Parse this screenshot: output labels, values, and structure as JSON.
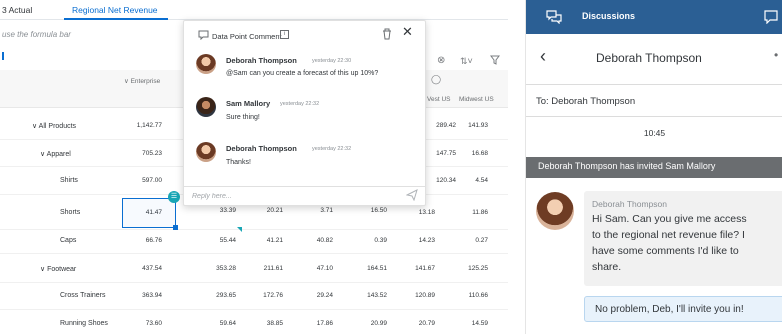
{
  "tabs": [
    {
      "label": "3 Actual",
      "active": false
    },
    {
      "label": "Regional Net Revenue",
      "active": true
    }
  ],
  "formula_hint": "use the formula bar",
  "columns": {
    "enterprise": "∨ Enterprise",
    "west_us": "Vest US",
    "midwest_us": "Midwest US"
  },
  "rows": [
    {
      "label": "∨ All Products",
      "values": [
        "1,142.77",
        "",
        "",
        "",
        "",
        "289.42",
        "141.93"
      ]
    },
    {
      "label": "∨ Apparel",
      "values": [
        "705.23",
        "",
        "",
        "",
        "",
        "147.75",
        "16.68"
      ]
    },
    {
      "label": "Shirts",
      "values": [
        "597.00",
        "",
        "",
        "",
        "",
        "120.34",
        "4.54"
      ]
    },
    {
      "label": "Shorts",
      "values": [
        "41.47",
        "33.39",
        "20.21",
        "3.71",
        "16.50",
        "13.18",
        "11.86"
      ]
    },
    {
      "label": "Caps",
      "values": [
        "66.76",
        "55.44",
        "41.21",
        "40.82",
        "0.39",
        "14.23",
        "0.27"
      ]
    },
    {
      "label": "∨ Footwear",
      "values": [
        "437.54",
        "353.28",
        "211.61",
        "47.10",
        "164.51",
        "141.67",
        "125.25"
      ]
    },
    {
      "label": "Cross Trainers",
      "values": [
        "363.94",
        "293.65",
        "172.76",
        "29.24",
        "143.52",
        "120.89",
        "110.66"
      ]
    },
    {
      "label": "Running Shoes",
      "values": [
        "73.60",
        "59.64",
        "38.85",
        "17.86",
        "20.99",
        "20.79",
        "14.59"
      ]
    }
  ],
  "popover": {
    "title": "Data Point Comment",
    "info": "i",
    "comments": [
      {
        "name": "Deborah Thompson",
        "time": "yesterday 22:30",
        "text": "@Sam can you create a forecast of this up 10%?"
      },
      {
        "name": "Sam Mallory",
        "time": "yesterday 22:32",
        "text": "Sure thing!"
      },
      {
        "name": "Deborah Thompson",
        "time": "yesterday 22:32",
        "text": "Thanks!"
      }
    ],
    "reply_placeholder": "Reply here..."
  },
  "discussion": {
    "header_title": "Discussions",
    "contact": "Deborah Thompson",
    "to": "To: Deborah Thompson",
    "time": "10:45",
    "banner": "Deborah Thompson has invited Sam Mallory",
    "message": {
      "name": "Deborah Thompson",
      "lines": [
        "Hi Sam. Can you give me access",
        "to the regional net revenue file? I",
        "have some comments I'd like to",
        "share."
      ]
    },
    "reply": "No problem, Deb, I'll invite you in!"
  },
  "colors": {
    "accent": "#0a6ed1",
    "teal": "#19a6b5",
    "header": "#2b5f94",
    "banner": "#6a6d70"
  }
}
